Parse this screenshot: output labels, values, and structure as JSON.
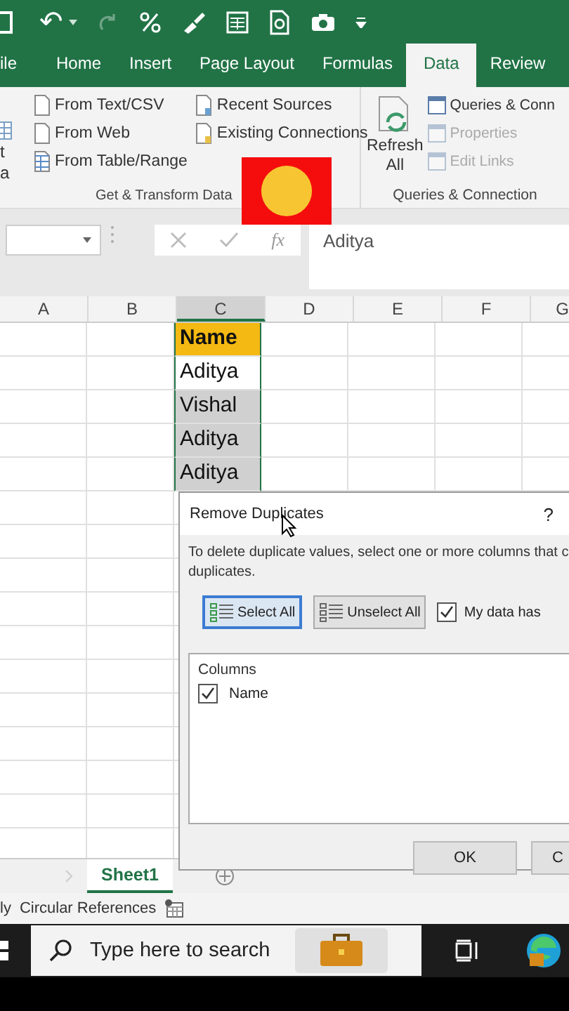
{
  "quick_access": {
    "undo": "↶",
    "redo_disabled": true
  },
  "tabs": [
    {
      "label": "ile",
      "selected": false
    },
    {
      "label": "Home",
      "selected": false
    },
    {
      "label": "Insert",
      "selected": false
    },
    {
      "label": "Page Layout",
      "selected": false
    },
    {
      "label": "Formulas",
      "selected": false
    },
    {
      "label": "Data",
      "selected": true
    },
    {
      "label": "Review",
      "selected": false
    }
  ],
  "ribbon": {
    "get_data_fragment": [
      "t",
      "a"
    ],
    "get_transform": {
      "col1": [
        {
          "label": "From Text/CSV",
          "disabled": false
        },
        {
          "label": "From Web",
          "disabled": false
        },
        {
          "label": "From Table/Range",
          "disabled": false
        }
      ],
      "col2": [
        {
          "label": "Recent Sources",
          "disabled": false
        },
        {
          "label": "Existing Connections",
          "disabled": false
        }
      ],
      "label": "Get & Transform Data"
    },
    "queries": {
      "refresh": [
        "Refresh",
        "All"
      ],
      "items": [
        {
          "label": "Queries & Conn",
          "disabled": false
        },
        {
          "label": "Properties",
          "disabled": true
        },
        {
          "label": "Edit Links",
          "disabled": true
        }
      ],
      "label": "Queries & Connection"
    }
  },
  "formula_bar": {
    "value": "Aditya",
    "fx": "fx"
  },
  "columns": [
    "A",
    "B",
    "C",
    "D",
    "E",
    "F",
    "G"
  ],
  "cells": [
    {
      "text": "Name",
      "kind": "header"
    },
    {
      "text": "Aditya",
      "kind": "active"
    },
    {
      "text": "Vishal",
      "kind": "selected"
    },
    {
      "text": "Aditya",
      "kind": "selected"
    },
    {
      "text": "Aditya",
      "kind": "selected"
    }
  ],
  "dialog": {
    "title": "Remove Duplicates",
    "help": "?",
    "lines": [
      "To delete duplicate values, select one or more columns that c",
      "duplicates."
    ],
    "buttons": [
      {
        "label": "Select All",
        "selected": true
      },
      {
        "label": "Unselect All",
        "selected": false
      }
    ],
    "header_checkbox": {
      "label": "My data has",
      "checked": true
    },
    "columns_label": "Columns",
    "column_items": [
      {
        "label": "Name",
        "checked": true
      }
    ],
    "actions": [
      "OK",
      "C"
    ]
  },
  "sheet_tabs": [
    {
      "label": "Sheet1",
      "selected": true
    }
  ],
  "status_bar": [
    "ly",
    "Circular References"
  ],
  "taskbar": {
    "search_placeholder": "Type here to search"
  }
}
